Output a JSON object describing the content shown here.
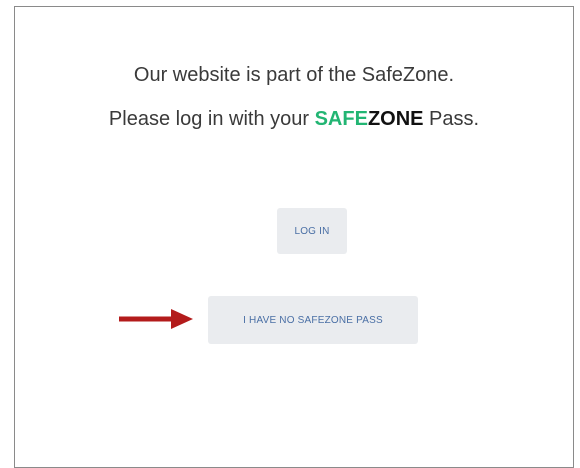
{
  "message": {
    "line1": "Our website is part of the SafeZone.",
    "line2_prefix": "Please log in with your ",
    "brand_part1": "SAFE",
    "brand_part2": "ZONE",
    "line2_suffix": " Pass."
  },
  "buttons": {
    "login_label": "LOG IN",
    "no_pass_label": "I HAVE NO SAFEZONE PASS"
  },
  "colors": {
    "brand_green": "#22b573",
    "arrow_red": "#b31b1b",
    "button_bg": "#eaecef",
    "button_text": "#4a6fa5"
  },
  "icons": {
    "arrow": "arrow-right-icon"
  }
}
